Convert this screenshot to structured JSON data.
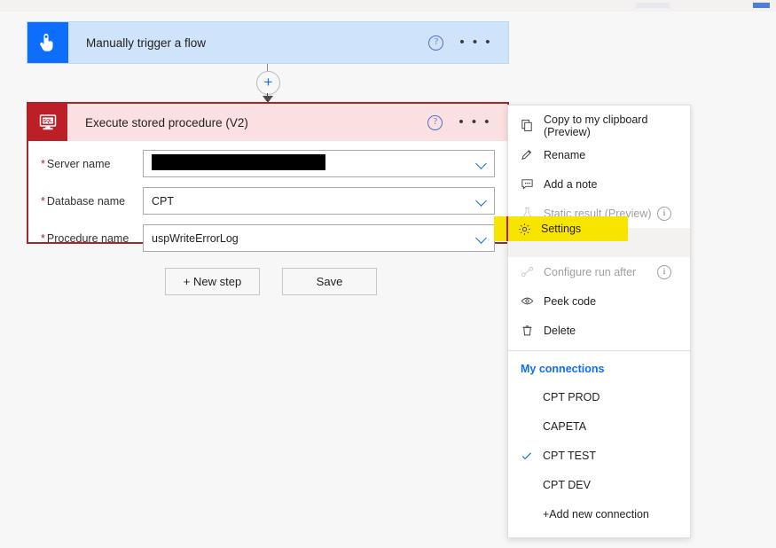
{
  "canvas": {
    "background_color": "#f7f7f7"
  },
  "trigger_card": {
    "title": "Manually trigger a flow",
    "icon": "tap-hand-icon",
    "icon_background": "#0d6efd",
    "card_background": "#cfe4fa",
    "help_icon": "help-circle-icon",
    "overflow_icon": "ellipsis-icon"
  },
  "connector": {
    "add_icon": "plus-icon",
    "arrow_icon": "down-arrow-icon"
  },
  "action_card": {
    "title": "Execute stored procedure (V2)",
    "icon": "sql-server-icon",
    "icon_background": "#bc2026",
    "header_background": "#fbe0e2",
    "border_color": "#a4262c",
    "help_icon": "help-circle-icon",
    "overflow_icon": "ellipsis-icon",
    "fields": [
      {
        "label": "Server name",
        "required_marker": "*",
        "value": "",
        "redacted": true,
        "chevron_icon": "chevron-down-icon"
      },
      {
        "label": "Database name",
        "required_marker": "*",
        "value": "CPT",
        "redacted": false,
        "chevron_icon": "chevron-down-icon"
      },
      {
        "label": "Procedure name",
        "required_marker": "*",
        "value": "uspWriteErrorLog",
        "redacted": false,
        "chevron_icon": "chevron-down-icon"
      }
    ]
  },
  "buttons": {
    "new_step": "+ New step",
    "save": "Save"
  },
  "context_menu": {
    "items": [
      {
        "label": "Copy to my clipboard (Preview)",
        "icon": "copy-icon",
        "disabled": false,
        "has_info": false,
        "highlighted": false
      },
      {
        "label": "Rename",
        "icon": "pencil-icon",
        "disabled": false,
        "has_info": false,
        "highlighted": false
      },
      {
        "label": "Add a note",
        "icon": "note-icon",
        "disabled": false,
        "has_info": false,
        "highlighted": false
      },
      {
        "label": "Static result (Preview)",
        "icon": "flask-icon",
        "disabled": true,
        "has_info": true,
        "highlighted": false
      },
      {
        "label": "Settings",
        "icon": "gear-icon",
        "disabled": false,
        "has_info": false,
        "highlighted": true
      },
      {
        "label": "Configure run after",
        "icon": "run-after-icon",
        "disabled": true,
        "has_info": true,
        "highlighted": false
      },
      {
        "label": "Peek code",
        "icon": "eye-icon",
        "disabled": false,
        "has_info": false,
        "highlighted": false
      },
      {
        "label": "Delete",
        "icon": "trash-icon",
        "disabled": false,
        "has_info": false,
        "highlighted": false
      }
    ],
    "info_icon": "info-circle-icon",
    "connections_title": "My connections",
    "connections_title_color": "#0d6efd",
    "connections": [
      {
        "label": "CPT PROD",
        "selected": false
      },
      {
        "label": "CAPETA",
        "selected": false
      },
      {
        "label": "CPT TEST",
        "selected": true
      },
      {
        "label": "CPT DEV",
        "selected": false
      },
      {
        "label": "+Add new connection",
        "selected": false
      }
    ],
    "check_icon": "check-icon"
  },
  "annotation": {
    "highlight_color": "#f7e500",
    "highlight_target": "Settings"
  }
}
